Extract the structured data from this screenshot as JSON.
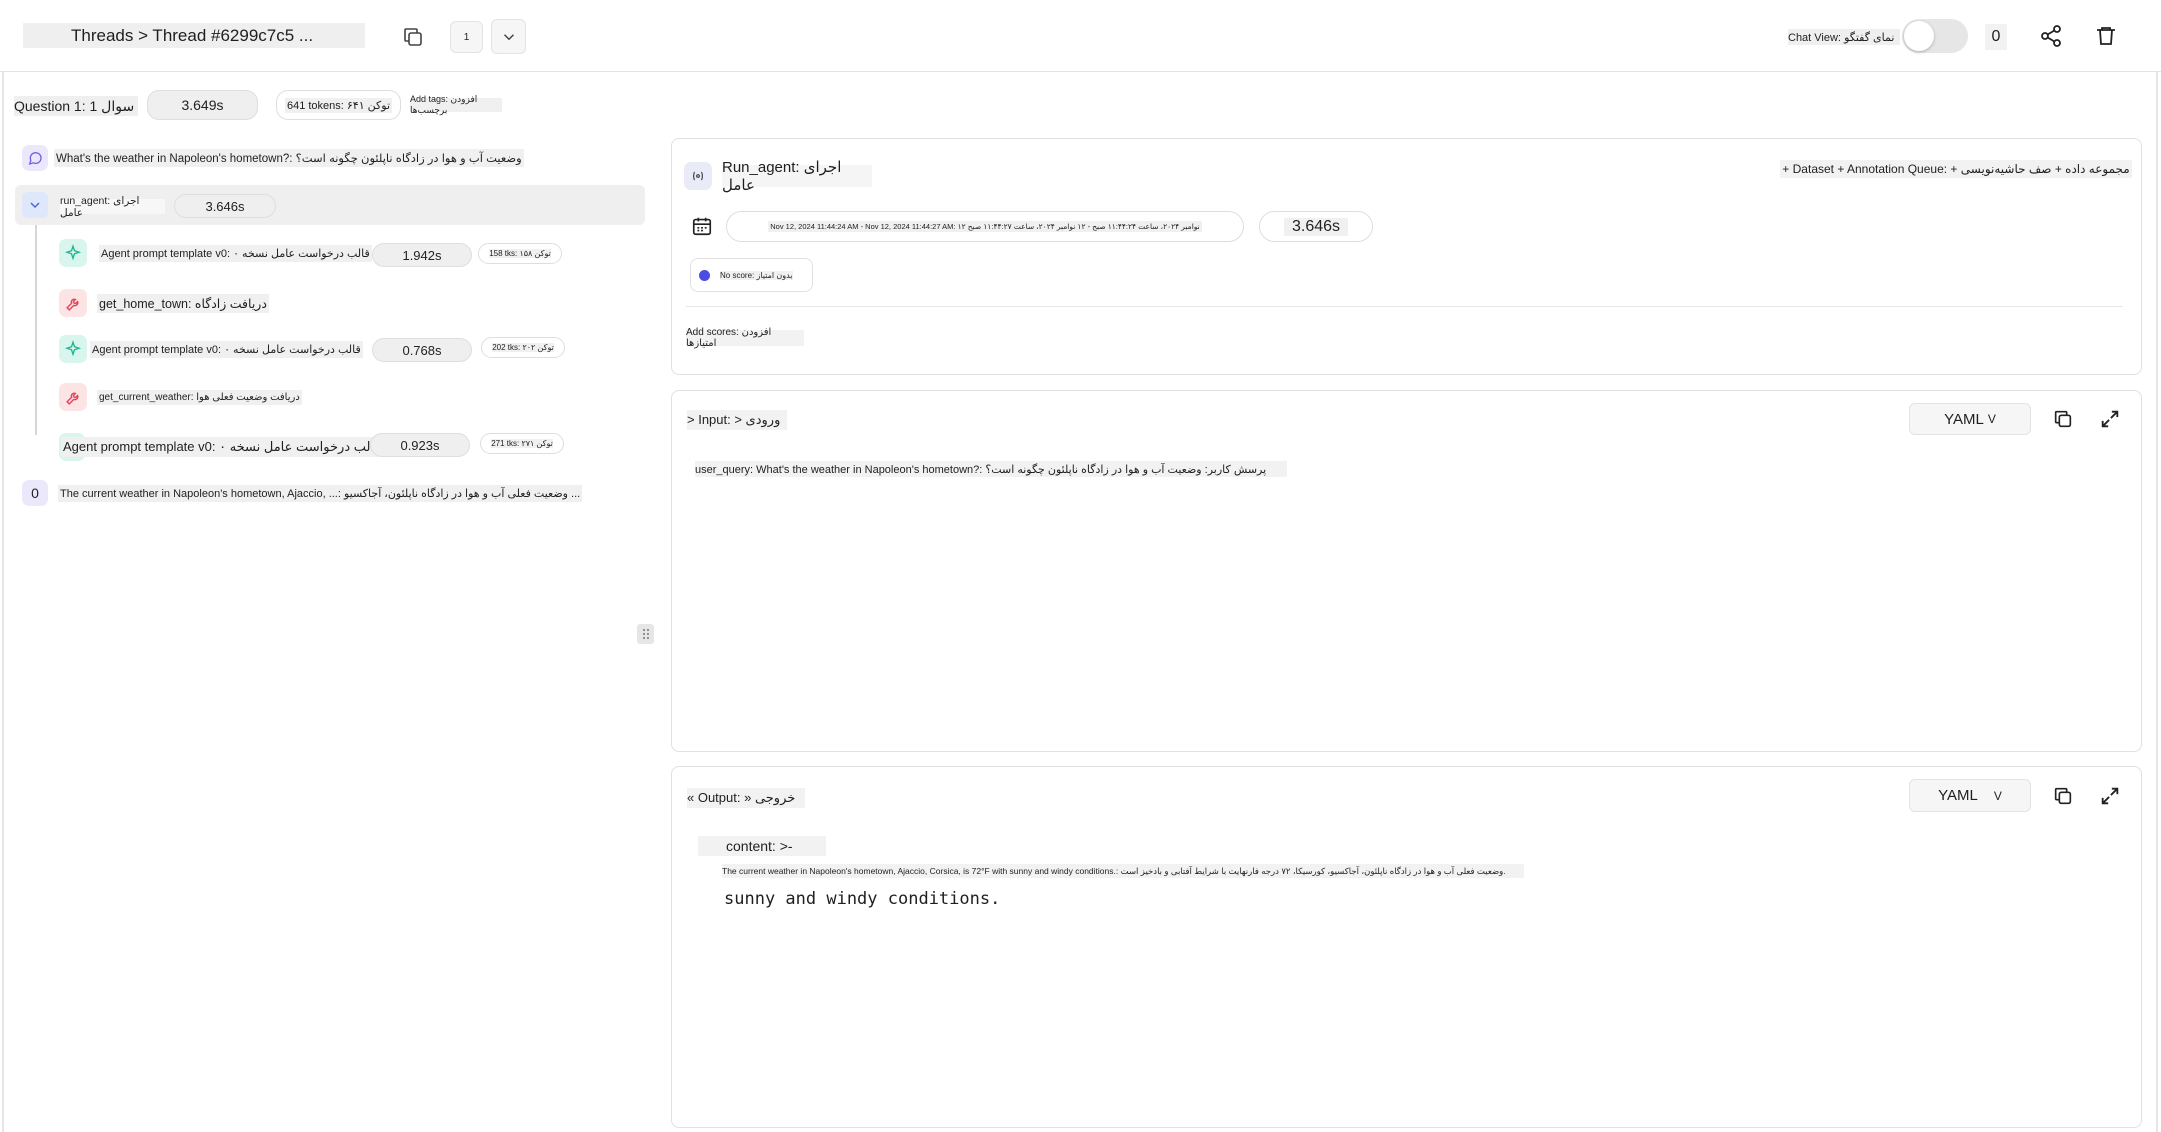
{
  "header": {
    "breadcrumb": "Threads > Thread #6299c7c5 ...",
    "page_indicator": "1",
    "chat_view_label": "Chat View: نمای گفتگو",
    "count": "0"
  },
  "question_bar": {
    "label": "Question 1: سوال 1",
    "latency": "3.649s",
    "tokens": "641 tokens: توکن ۶۴۱",
    "add_tags": "Add tags: افزودن برچسب‌ها"
  },
  "tree": {
    "question": "What's the weather in Napoleon's hometown?: وضعیت آب و هوا در زادگاه ناپلئون چگونه است؟",
    "run_agent": {
      "label": "run_agent: اجرای عامل",
      "latency": "3.646s"
    },
    "children": [
      {
        "label": "Agent prompt template v0: قالب درخواست عامل نسخه ۰",
        "latency": "1.942s",
        "tokens": "158 tks: توکن ۱۵۸",
        "kind": "llm"
      },
      {
        "label": "get_home_town: دریافت زادگاه",
        "latency": "",
        "tokens": "",
        "kind": "tool"
      },
      {
        "label": "Agent prompt template v0: قالب درخواست عامل نسخه ۰",
        "latency": "0.768s",
        "tokens": "202 tks: توکن ۲۰۲",
        "kind": "llm"
      },
      {
        "label": "get_current_weather: دریافت وضعیت فعلی هوا",
        "latency": "",
        "tokens": "",
        "kind": "tool"
      },
      {
        "label": "Agent prompt template v0: قالب درخواست عامل نسخه ۰",
        "latency": "0.923s",
        "tokens": "271 tks: توکن ۲۷۱",
        "kind": "llm"
      }
    ],
    "answer_index": "0",
    "answer": "The current weather in Napoleon's hometown, Ajaccio, ...: وضعیت فعلی آب و هوا در زادگاه ناپلئون، آجاکسیو ..."
  },
  "run_panel": {
    "title": "Run_agent: اجرای عامل",
    "actions": "+ Dataset + Annotation Queue: + مجموعه داده + صف حاشیه‌نویسی",
    "time_range": "Nov 12, 2024 11:44:24 AM - Nov 12, 2024 11:44:27 AM: ۱۲ نوامبر ۲۰۲۴، ساعت ۱۱:۴۴:۲۴ صبح - ۱۲ نوامبر ۲۰۲۴، ساعت ۱۱:۴۴:۲۷ صبح",
    "latency": "3.646s",
    "score_tag": "No score: بدون امتیاز",
    "add_scores": "Add scores: افزودن امتیازها",
    "score_dot_color": "#4a4de0"
  },
  "input_panel": {
    "title": "> Input: > ورودی",
    "format": "YAML",
    "content": "user_query: What's the weather in Napoleon's hometown?: پرسش کاربر: وضعیت آب و هوا در زادگاه ناپلئون چگونه است؟"
  },
  "output_panel": {
    "title": "« Output: » خروجی",
    "format": "YAML",
    "content_key": "content: >-",
    "content_line": "The current weather in Napoleon's hometown, Ajaccio, Corsica, is 72°F with sunny and windy conditions.: وضعیت فعلی آب و هوا در زادگاه ناپلئون، آجاکسیو، کورسیکا، ۷۲ درجه فارنهایت با شرایط آفتابی و بادخیز است.",
    "content_mono": "sunny and windy conditions."
  },
  "colors": {
    "llm_icon_bg": "#d8f5ee",
    "llm_icon": "#1fb58f",
    "tool_icon_bg": "#fde4e4",
    "tool_icon": "#e0455a",
    "msg_icon_bg": "#ece8fb",
    "msg_icon": "#7c5ce8"
  }
}
